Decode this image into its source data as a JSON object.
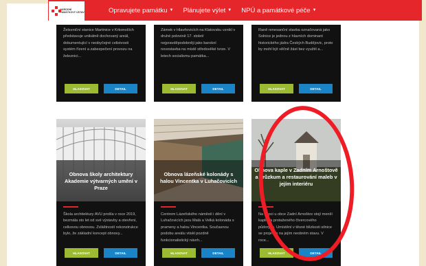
{
  "nav": {
    "logo_text": "NÁRODNÍ PAMÁTKOVÝ ÚSTAV",
    "items": [
      {
        "label": "Opravujete památku"
      },
      {
        "label": "Plánujete výlet"
      },
      {
        "label": "NPÚ a památkové péče"
      }
    ]
  },
  "colors": {
    "nav_bg": "#e5262a",
    "card_bg": "#111111",
    "vote_button": "#9dba33",
    "detail_button": "#1a84c7",
    "highlight_ellipse": "#ee1c25"
  },
  "top_cards": [
    {
      "desc": "Železniční stanice Martinice v Krkonoších představuje unikátně dochovaný areál, dokumentující v neobyčejné celistvosti systém řízení a zabezpečení provozu na železnici...",
      "vote_label": "HLASOVAT",
      "detail_label": "DETAIL"
    },
    {
      "desc": "Zámek v Hlavňovicích na Klatovsku vznikl v druhé polovině 17. století nejpravděpodobněji jako barokní novostavba na místě středověké tvrze. V letech socialismu památka...",
      "vote_label": "HLASOVAT",
      "detail_label": "DETAIL"
    },
    {
      "desc": "Raně renesanční stavba označovaná jako Solnice je jednou z hlavních dominant historického jádra Českých Budějovic, proto by mohl být věčně žást bez využití a...",
      "vote_label": "HLASOVAT",
      "detail_label": "DETAIL"
    }
  ],
  "cards": [
    {
      "title": "Obnova školy architektury Akademie výtvarných umění v Praze",
      "desc": "Škola architektury AVU prošla v roce 2019, bezmála sto let od své výstavby a otevření, celkovou obnovou. Zvláštností rekonstrukce bylo, že základní koncept obnovy...",
      "vote_label": "HLASOVAT",
      "detail_label": "DETAIL"
    },
    {
      "title": "Obnova lázeňské kolonády s halou Vincentka v Luhačovicích",
      "desc": "Centrem Lázeňského náměstí i dění v Luhačovicích jsou Malá a Velká kolonáda s prameny a halou Vincentka. Současnou podobu areálu vtiskl pozdně funkcionalistický návrh...",
      "vote_label": "HLASOVAT",
      "detail_label": "DETAIL"
    },
    {
      "title": "Obnova kaple v Zadním Arnoštově a průzkum a restaurování maleb v jejím interiéru",
      "desc": "Na kopci u obce Zadní Arnoštov stojí menší kaplička protaženého čtvercového půdorysu. Umístění v těsné blízkosti silnice se projevilo na jejím neobrém stavu. V roce...",
      "vote_label": "HLASOVAT",
      "detail_label": "DETAIL"
    }
  ]
}
